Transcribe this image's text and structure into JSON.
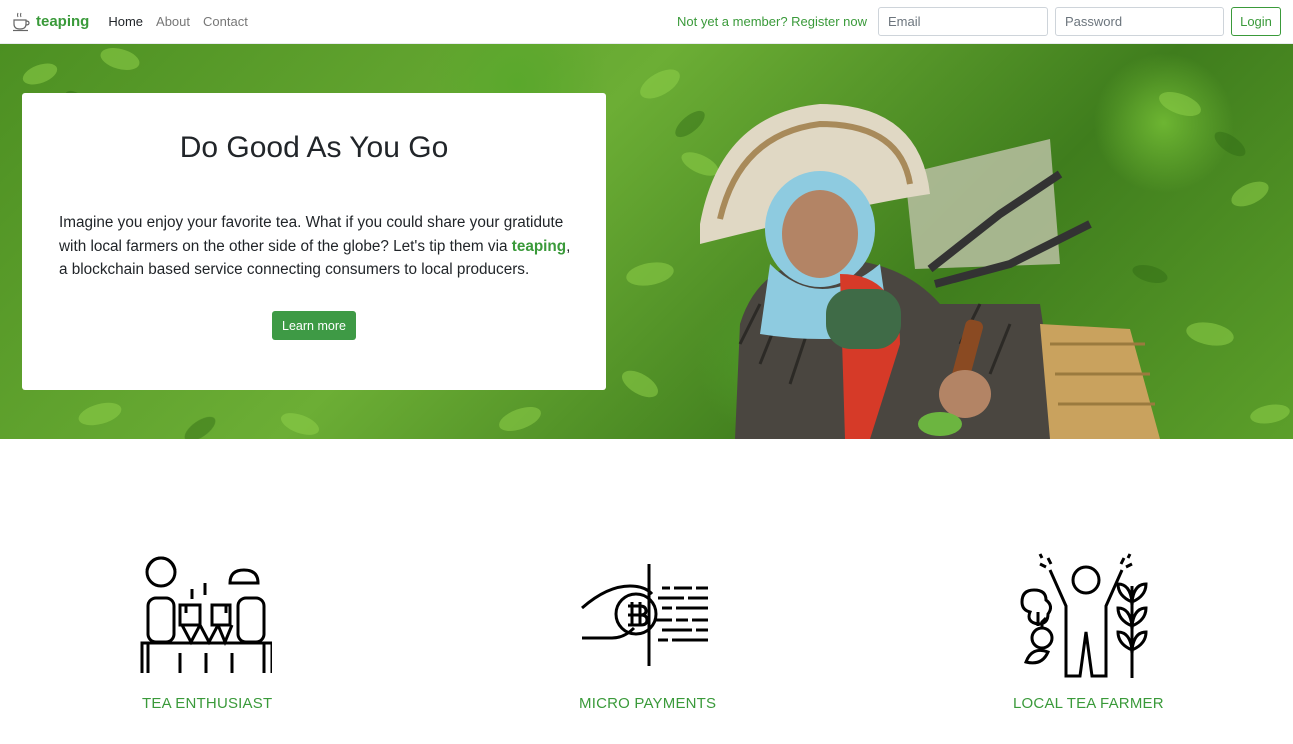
{
  "nav": {
    "brand": "teaping",
    "links": [
      "Home",
      "About",
      "Contact"
    ],
    "register": "Not yet a member? Register now",
    "email_placeholder": "Email",
    "password_placeholder": "Password",
    "login": "Login"
  },
  "hero": {
    "title": "Do Good As You Go",
    "text_before": "Imagine you enjoy your favorite tea. What if you could share your gratidute with local farmers on the other side of the globe? Let's tip them via ",
    "text_brand": "teaping",
    "text_after": ", a blockchain based service connecting consumers to local producers.",
    "button": "Learn more"
  },
  "features": [
    {
      "label": "TEA ENTHUSIAST",
      "icon": "tea-enthusiasts-icon"
    },
    {
      "label": "MICRO PAYMENTS",
      "icon": "bitcoin-payment-icon"
    },
    {
      "label": "LOCAL TEA FARMER",
      "icon": "farmer-icon"
    }
  ],
  "colors": {
    "brand": "#3a9a3a",
    "button": "#3e9a45"
  }
}
